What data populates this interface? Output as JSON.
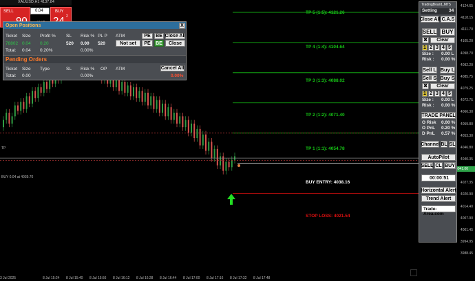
{
  "colors": {
    "bull": "#2f9e44",
    "bear": "#d9534f",
    "tp": "#16c516",
    "sl": "#e01010",
    "entry": "#ffffff",
    "panel": "#4a4d52",
    "accent": "#2fa44a"
  },
  "trade_widget": {
    "sell_label": "SELL",
    "buy_label": "BUY",
    "lots": "0.04",
    "sell_big": "90",
    "sell_small": "4044",
    "buy_big": "24",
    "buy_small": "4045",
    "spread": "2",
    "symbol": "XAUUSD"
  },
  "symbol_header": "XAUUSD,H1 4137.84",
  "open_positions": {
    "title": "Open Positions",
    "headers": [
      "Ticket",
      "Size",
      "Profit %",
      "SL",
      "Risk %",
      "PL P",
      "ATM"
    ],
    "row": {
      "ticket": "78802",
      "size": "0.04",
      "profit": "0.20",
      "sl": "520",
      "risk": "0.00",
      "plp": "520"
    },
    "total": {
      "label": "Total:",
      "size": "0.04",
      "profit": "0.20%",
      "risk": "0.00%"
    },
    "buttons": {
      "pe": "PE",
      "be": "BE",
      "close_all": "Close All",
      "not_set": "Not set",
      "pe2": "PE",
      "be2": "BE",
      "close": "Close"
    },
    "close_x": "X"
  },
  "pending_orders": {
    "title": "Pending Orders",
    "headers": [
      "Ticket",
      "Size",
      "Type",
      "SL",
      "Risk %",
      "OP",
      "ATM"
    ],
    "total": {
      "label": "Total:",
      "size": "0.00",
      "risk": "0.00%",
      "red": "0.00%"
    },
    "cancel_all": "Cancel All"
  },
  "chart_labels": {
    "tp5": "TP 5 (1:5): 4121.26",
    "tp4": "TP 4 (1:4): 4104.64",
    "tp3": "TP 3 (1:3): 4088.02",
    "tp2": "TP 2 (1:2): 4071.40",
    "tp1": "TP 1 (1:1): 4054.78",
    "buy_entry": "BUY ENTRY: 4038.16",
    "stop_loss": "STOP LOSS: 4021.54",
    "tp_tag": "TP",
    "buy_tag": "BUY 0.04 at 4039.70"
  },
  "y_axis": [
    "4124.65",
    "4118.15",
    "4111.70",
    "4105.20",
    "4098.70",
    "4092.20",
    "4085.75",
    "4079.25",
    "4072.75",
    "4066.30",
    "4059.80",
    "4053.30",
    "4046.80",
    "4040.35",
    "4033.85",
    "4027.35",
    "4020.90",
    "4014.40",
    "4007.90",
    "4001.45",
    "3994.95",
    "3988.45"
  ],
  "y_axis_highlight": "4041.00",
  "x_axis": [
    "3 Jul 2025",
    "8 Jul 15:24",
    "8 Jul 15:40",
    "8 Jul 15:56",
    "8 Jul 16:12",
    "8 Jul 16:28",
    "8 Jul 16:44",
    "8 Jul 17:00",
    "8 Jul 17:16",
    "8 Jul 17:32",
    "8 Jul 17:48"
  ],
  "right_panel": {
    "title": "TradingBoard_MT5",
    "setting": "Setting",
    "setting_num": "34",
    "close_all": "Close All",
    "cas": "C.A.S",
    "sell": "SELL",
    "buy": "BUY",
    "clear": "Clear",
    "nums": [
      "1",
      "2",
      "3",
      "4",
      "5"
    ],
    "size_label": "Size :",
    "size_val": "0.00 L",
    "risk_label": "Risk :",
    "risk_val": "0.00 %",
    "sell_l": "Sell L",
    "buy_l": "Buy L",
    "sell_s": "Sell S",
    "buy_s": "Buy S",
    "clear2": "Clear",
    "size_val2": "0.00 L",
    "risk_val2": "0.00 %",
    "trade_panel": "TRADE PANEL",
    "o_risk_label": "O Risk",
    "o_risk_val": "0.00 %",
    "o_pnl_label": "O PnL",
    "o_pnl_val": "0.20 %",
    "d_pnl_label": "D PnL",
    "d_pnl_val": "0.57 %",
    "channel": "Channel",
    "bl": "BL",
    "sl": "SL",
    "autopilot": "AutoPilot",
    "sell2": "SELL",
    "cl": "CL",
    "buy2": "BUY",
    "timer": "00:00:51",
    "h_alert": "Horizontal Alert",
    "t_alert": "Trend Alert",
    "site": "Trade-Area.com"
  }
}
